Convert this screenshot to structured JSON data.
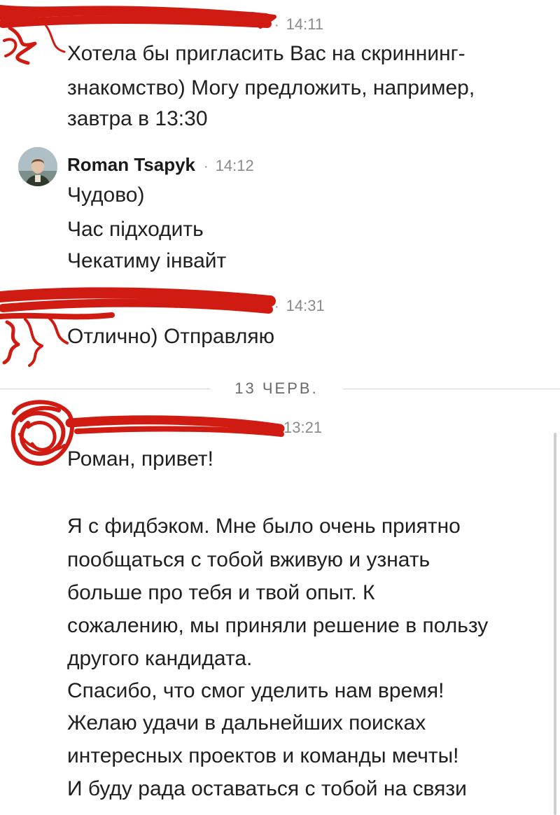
{
  "messages": [
    {
      "time": "14:11",
      "lines": [
        "Хотела бы пригласить Вас на скриннинг-",
        "знакомство) Могу предложить, например,",
        "завтра в 13:30"
      ]
    },
    {
      "sender": "Roman Tsapyk",
      "time": "14:12",
      "lines": [
        "Чудово)",
        "Час підходить",
        "Чекатиму інвайт"
      ]
    },
    {
      "time": "14:31",
      "lines": [
        "Отлично) Отправляю"
      ]
    },
    {
      "time": "13:21",
      "lines": [
        "Роман, привет!",
        "Я с фидбэком. Мне было очень приятно",
        "пообщаться с тобой вживую и узнать",
        "больше про тебя и твой опыт. К",
        "сожалению, мы приняли решение в пользу",
        "другого кандидата.",
        "Спасибо, что смог уделить нам время!",
        "Желаю удачи в дальнейших поисках",
        "интересных проектов и команды мечты!",
        "И буду рада оставаться с тобой на связи"
      ]
    }
  ],
  "date_divider": "13 ЧЕРВ.",
  "redaction_color": "#d01b12"
}
